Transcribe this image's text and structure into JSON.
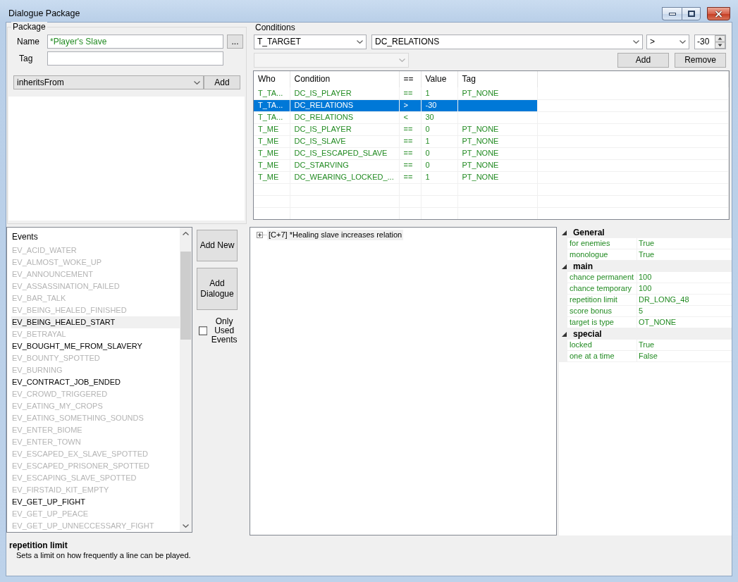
{
  "window": {
    "title": "Dialogue Package"
  },
  "package": {
    "title": "Package",
    "name_label": "Name",
    "name_value": "*Player's Slave",
    "browse_button": "...",
    "tag_label": "Tag",
    "inherits_select": "inheritsFrom",
    "add_button": "Add"
  },
  "conditions": {
    "title": "Conditions",
    "who_select": "T_TARGET",
    "condition_select": "DC_RELATIONS",
    "operator_select": ">",
    "value_spinner": "-30",
    "tag_select": {
      "disabled": true
    },
    "buttons": [
      "Add",
      "Remove"
    ],
    "columns": [
      "Who",
      "Condition",
      "==",
      "Value",
      "Tag"
    ],
    "rows": [
      {
        "who": "T_TA...",
        "condition": "DC_IS_PLAYER",
        "op": "==",
        "value": "1",
        "tag": "PT_NONE",
        "selected": false
      },
      {
        "who": "T_TA...",
        "condition": "DC_RELATIONS",
        "op": ">",
        "value": "-30",
        "selected": true
      },
      {
        "who": "T_TA...",
        "condition": "DC_RELATIONS",
        "op": "<",
        "value": "30",
        "selected": false
      },
      {
        "who": "T_ME",
        "condition": "DC_IS_PLAYER",
        "op": "==",
        "value": "0",
        "tag": "PT_NONE",
        "selected": false
      },
      {
        "who": "T_ME",
        "condition": "DC_IS_SLAVE",
        "op": "==",
        "value": "1",
        "tag": "PT_NONE",
        "selected": false
      },
      {
        "who": "T_ME",
        "condition": "DC_IS_ESCAPED_SLAVE",
        "op": "==",
        "value": "0",
        "tag": "PT_NONE",
        "selected": false
      },
      {
        "who": "T_ME",
        "condition": "DC_STARVING",
        "op": "==",
        "value": "0",
        "tag": "PT_NONE",
        "selected": false
      },
      {
        "who": "T_ME",
        "condition": "DC_WEARING_LOCKED_...",
        "op": "==",
        "value": "1",
        "tag": "PT_NONE",
        "selected": false
      }
    ]
  },
  "events": {
    "header": "Events",
    "items": [
      {
        "label": "EV_ACID_WATER",
        "used": false,
        "selected": false
      },
      {
        "label": "EV_ALMOST_WOKE_UP",
        "used": false,
        "selected": false
      },
      {
        "label": "EV_ANNOUNCEMENT",
        "used": false,
        "selected": false
      },
      {
        "label": "EV_ASSASSINATION_FAILED",
        "used": false,
        "selected": false
      },
      {
        "label": "EV_BAR_TALK",
        "used": false,
        "selected": false
      },
      {
        "label": "EV_BEING_HEALED_FINISHED",
        "used": false,
        "selected": false
      },
      {
        "label": "EV_BEING_HEALED_START",
        "used": true,
        "selected": true
      },
      {
        "label": "EV_BETRAYAL",
        "used": false,
        "selected": false
      },
      {
        "label": "EV_BOUGHT_ME_FROM_SLAVERY",
        "used": true,
        "selected": false
      },
      {
        "label": "EV_BOUNTY_SPOTTED",
        "used": false,
        "selected": false
      },
      {
        "label": "EV_BURNING",
        "used": false,
        "selected": false
      },
      {
        "label": "EV_CONTRACT_JOB_ENDED",
        "used": true,
        "selected": false
      },
      {
        "label": "EV_CROWD_TRIGGERED",
        "used": false,
        "selected": false
      },
      {
        "label": "EV_EATING_MY_CROPS",
        "used": false,
        "selected": false
      },
      {
        "label": "EV_EATING_SOMETHING_SOUNDS",
        "used": false,
        "selected": false
      },
      {
        "label": "EV_ENTER_BIOME",
        "used": false,
        "selected": false
      },
      {
        "label": "EV_ENTER_TOWN",
        "used": false,
        "selected": false
      },
      {
        "label": "EV_ESCAPED_EX_SLAVE_SPOTTED",
        "used": false,
        "selected": false
      },
      {
        "label": "EV_ESCAPED_PRISONER_SPOTTED",
        "used": false,
        "selected": false
      },
      {
        "label": "EV_ESCAPING_SLAVE_SPOTTED",
        "used": false,
        "selected": false
      },
      {
        "label": "EV_FIRSTAID_KIT_EMPTY",
        "used": false,
        "selected": false
      },
      {
        "label": "EV_GET_UP_FIGHT",
        "used": true,
        "selected": false
      },
      {
        "label": "EV_GET_UP_PEACE",
        "used": false,
        "selected": false
      },
      {
        "label": "EV_GET_UP_UNNECCESSARY_FIGHT",
        "used": false,
        "selected": false
      }
    ]
  },
  "actions": {
    "buttons": [
      "Add New",
      "Add Dialogue"
    ],
    "only_used": {
      "label": "Only Used Events",
      "checked": false
    }
  },
  "tree": {
    "nodes": [
      {
        "label": "[C+7] *Healing slave increases relation",
        "expanded": false,
        "selected": true
      }
    ]
  },
  "properties": {
    "categories": [
      {
        "name": "General",
        "expanded": true,
        "properties": [
          {
            "name": "for enemies",
            "value": "True"
          },
          {
            "name": "monologue",
            "value": "True"
          }
        ]
      },
      {
        "name": "main",
        "expanded": true,
        "properties": [
          {
            "name": "chance permanent",
            "value": "100"
          },
          {
            "name": "chance temporary",
            "value": "100"
          },
          {
            "name": "repetition limit",
            "value": "DR_LONG_48"
          },
          {
            "name": "score bonus",
            "value": "5"
          },
          {
            "name": "target is type",
            "value": "OT_NONE"
          }
        ]
      },
      {
        "name": "special",
        "expanded": true,
        "properties": [
          {
            "name": "locked",
            "value": "True"
          },
          {
            "name": "one at a time",
            "value": "False"
          }
        ]
      }
    ]
  },
  "help": {
    "title": "repetition limit",
    "description": "Sets a limit on how frequently a line can be played."
  }
}
